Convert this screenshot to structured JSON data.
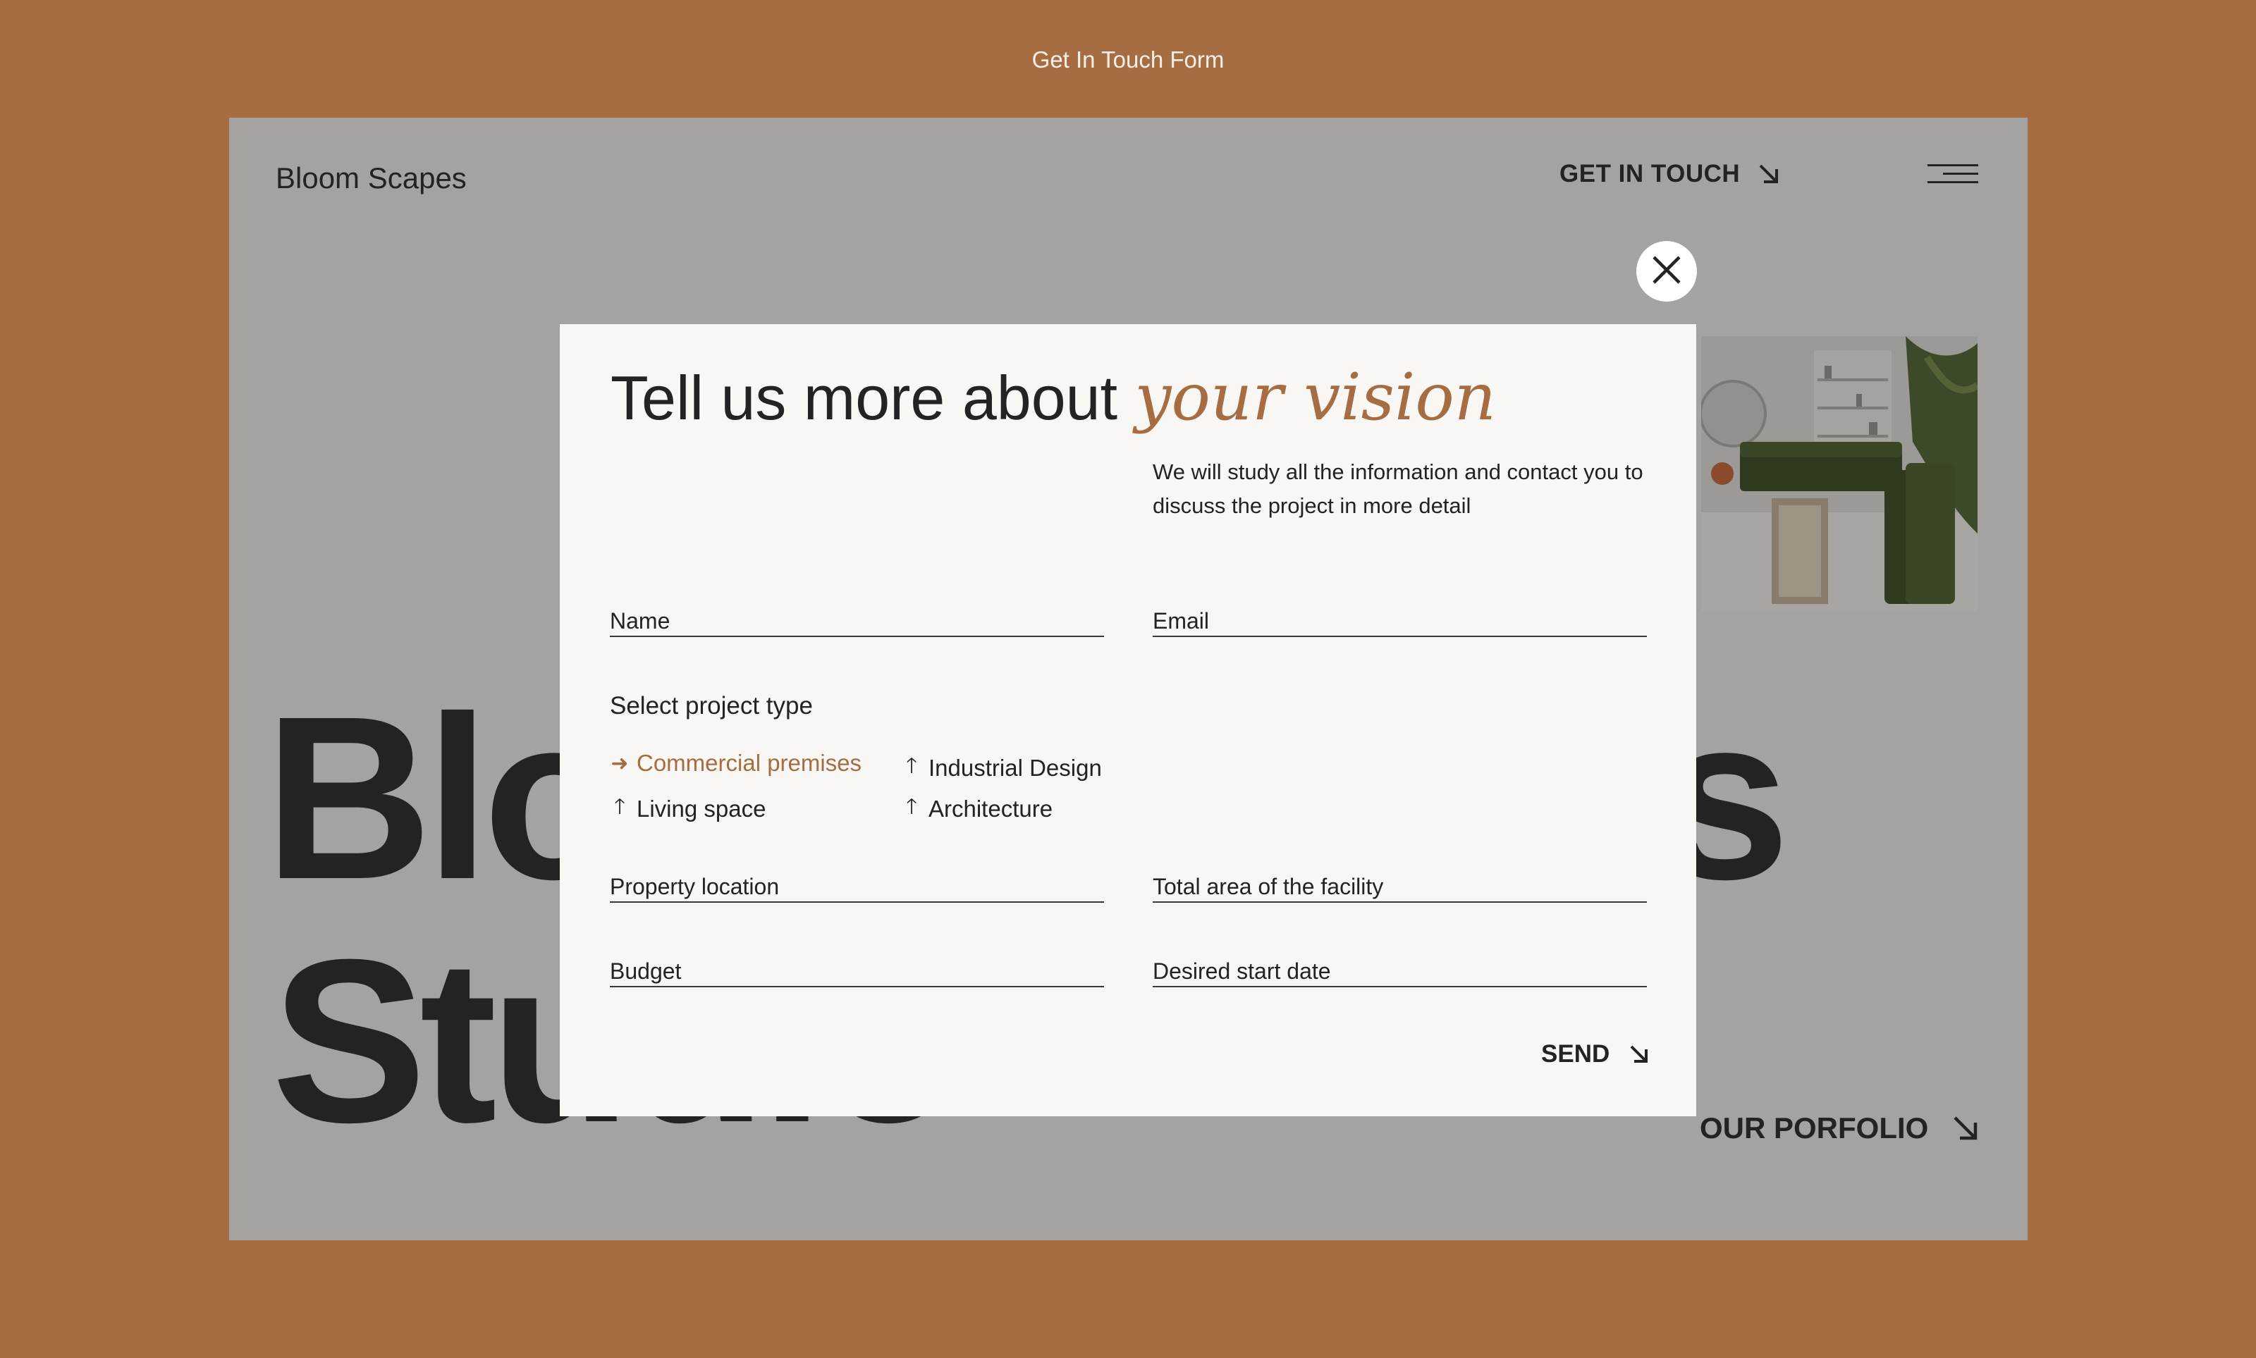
{
  "caption": "Get In Touch Form",
  "header": {
    "logo": "Bloom Scapes",
    "cta_label": "GET IN TOUCH",
    "cta_icon": "arrow-down-right-icon",
    "menu_icon": "menu-icon"
  },
  "hero": {
    "line1": "Bloom Scapes",
    "line2": "Studio"
  },
  "portfolio_link": "OUR PORFOLIO",
  "modal": {
    "title_plain": "Tell us more about ",
    "title_accent": "your vision",
    "subtitle": "We will study all the information and contact you to discuss the project in more detail",
    "fields": {
      "name": "Name",
      "email": "Email",
      "location": "Property location",
      "area": "Total area of the facility",
      "budget": "Budget",
      "start_date": "Desired start date"
    },
    "project_type": {
      "title": "Select project type",
      "options": [
        {
          "label": "Commercial premises",
          "selected": true,
          "icon": "arrow-right-icon"
        },
        {
          "label": "Industrial Design",
          "selected": false,
          "icon": "arrow-up-icon"
        },
        {
          "label": "Living space",
          "selected": false,
          "icon": "arrow-up-icon"
        },
        {
          "label": "Architecture",
          "selected": false,
          "icon": "arrow-up-icon"
        }
      ]
    },
    "send_label": "SEND",
    "close_icon": "close-icon"
  },
  "colors": {
    "accent": "#A66D43",
    "background": "#A66D43",
    "overlay": "#A4A3A1",
    "modal": "#F8F7F4",
    "text": "#232323"
  }
}
